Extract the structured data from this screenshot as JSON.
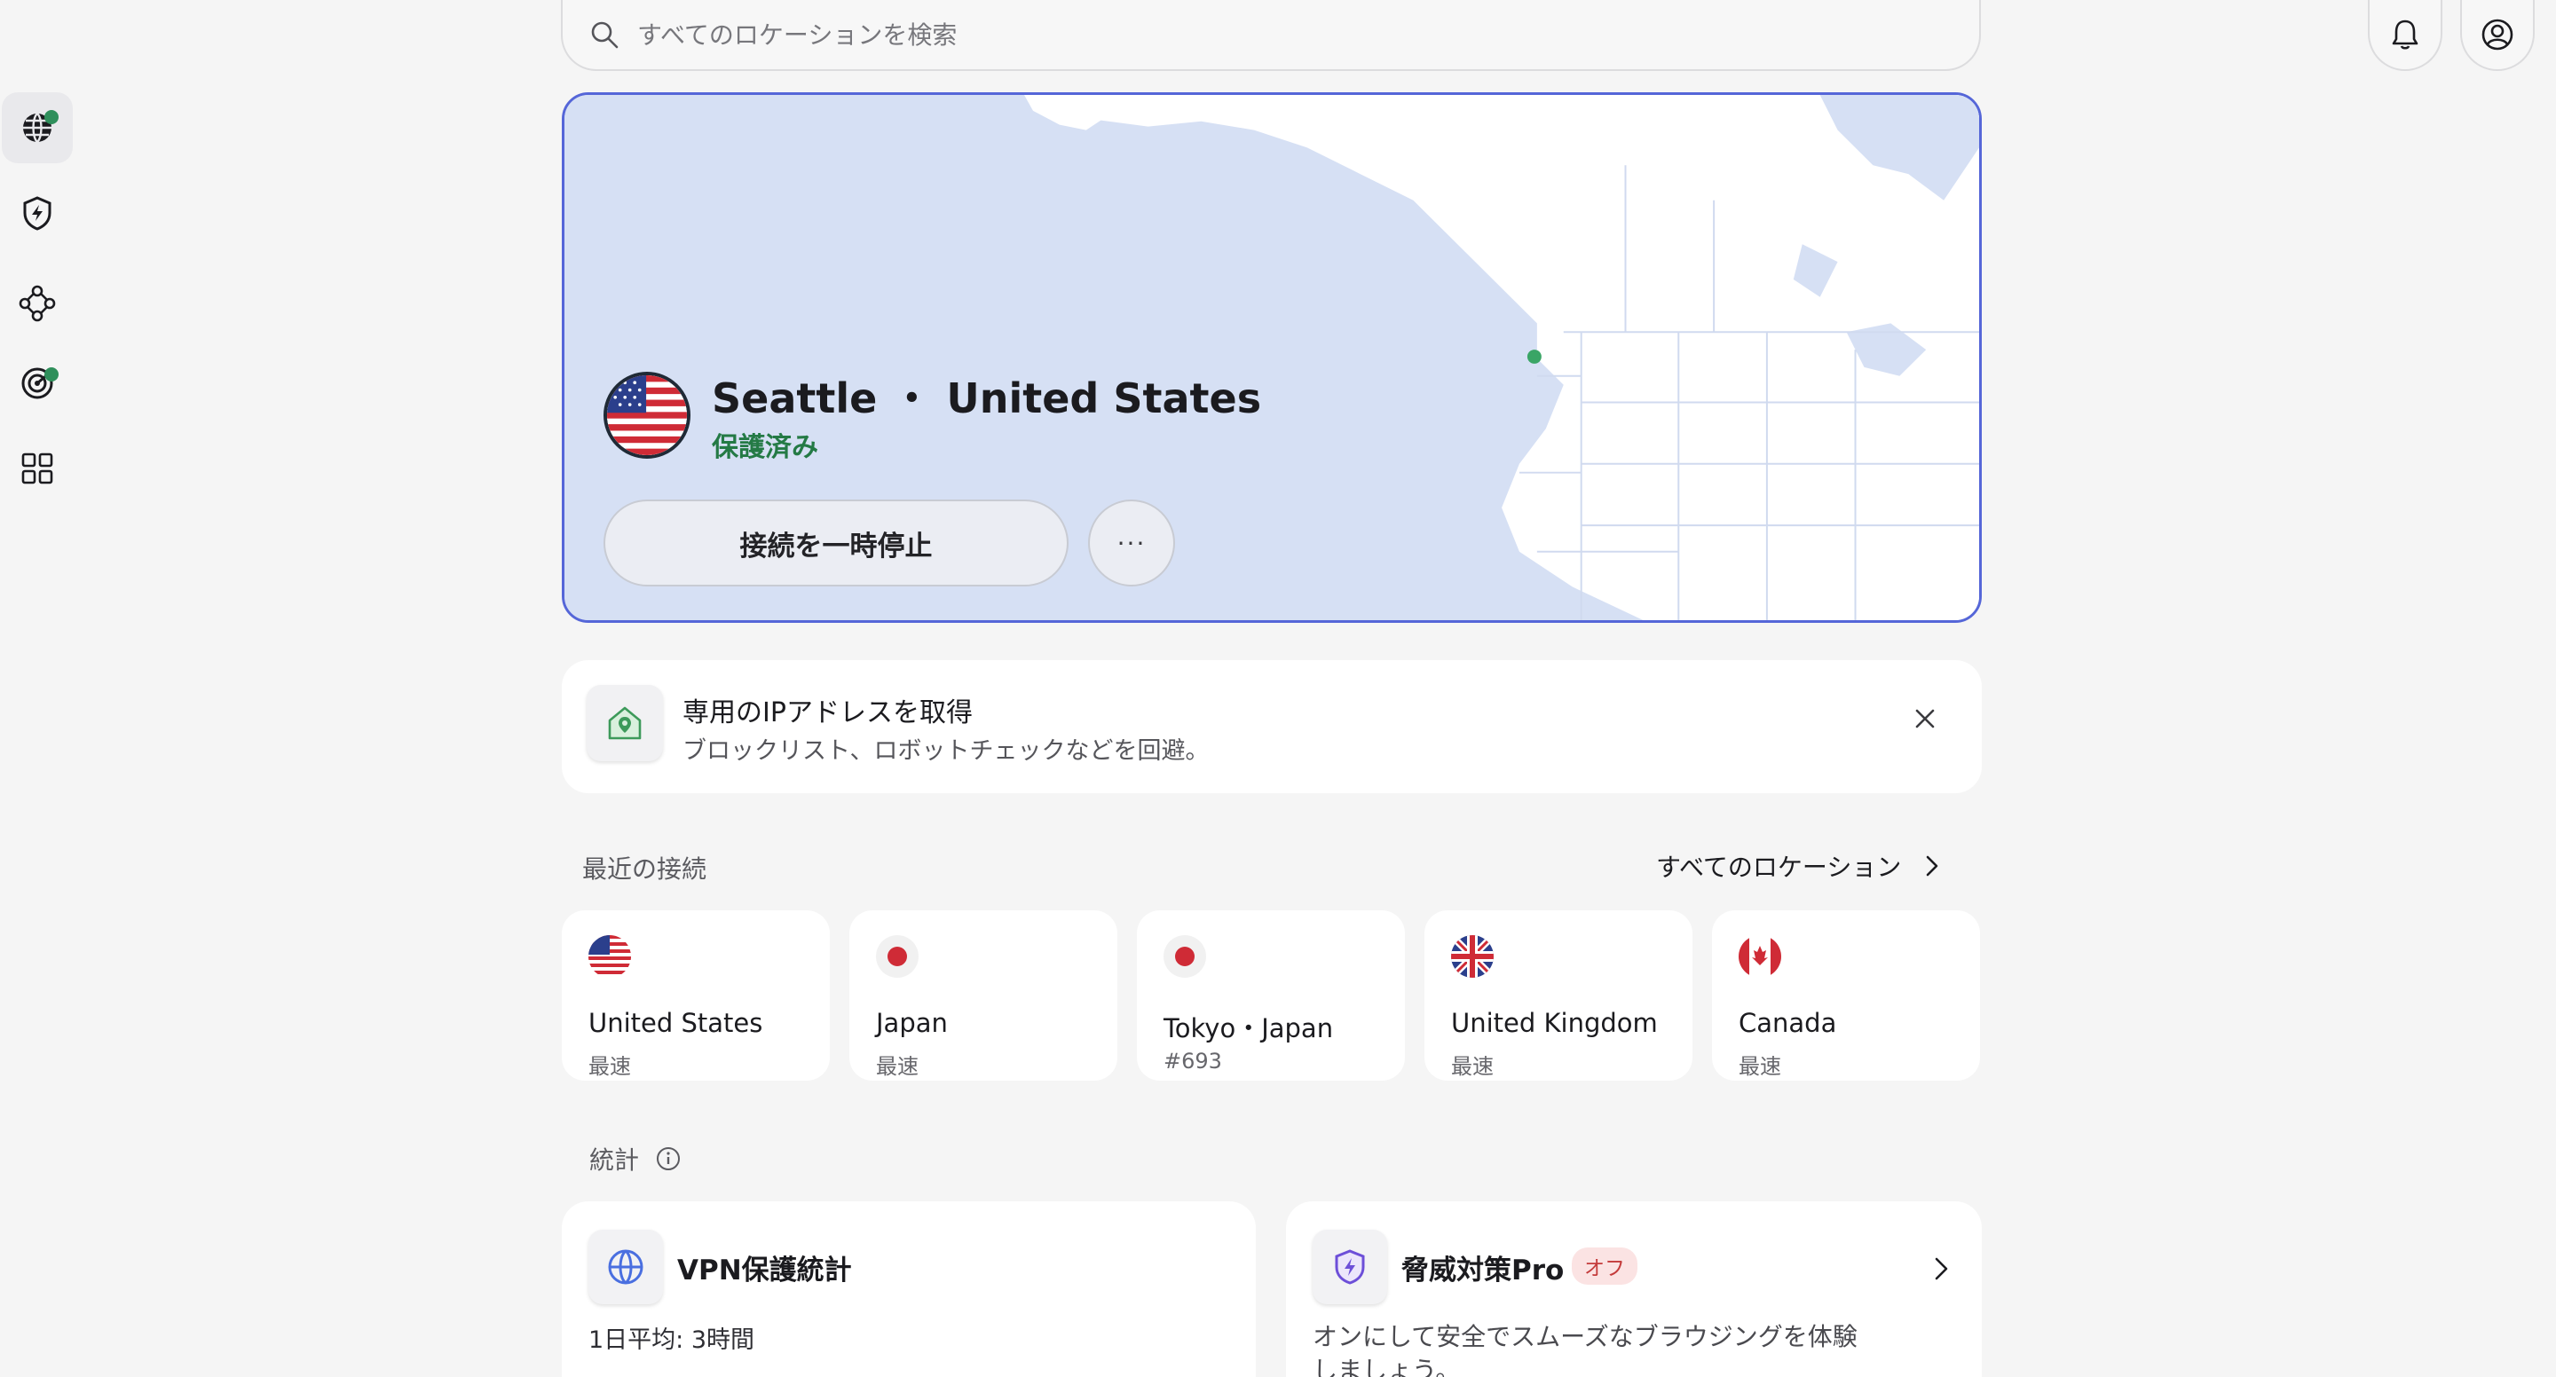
{
  "search": {
    "placeholder": "すべてのロケーションを検索"
  },
  "sidebar": {
    "items": [
      {
        "name": "globe-icon",
        "active": true,
        "badge": true
      },
      {
        "name": "threat-shield-icon",
        "active": false,
        "badge": false
      },
      {
        "name": "meshnet-icon",
        "active": false,
        "badge": false
      },
      {
        "name": "radar-icon",
        "active": false,
        "badge": true
      },
      {
        "name": "apps-grid-icon",
        "active": false,
        "badge": false
      }
    ]
  },
  "header": {
    "notifications_icon": "bell-icon",
    "account_icon": "user-icon"
  },
  "hero": {
    "location": "Seattle ・ United States",
    "status": "保護済み",
    "pause_label": "接続を一時停止",
    "more_label": "···",
    "status_color": "#247a45",
    "accent": "#5566d8"
  },
  "promo": {
    "title": "専用のIPアドレスを取得",
    "subtitle": "ブロックリスト、ロボットチェックなどを回避。"
  },
  "recent": {
    "label": "最近の接続",
    "all_label": "すべてのロケーション",
    "items": [
      {
        "flag": "us",
        "name": "United States",
        "sub": "最速"
      },
      {
        "flag": "jp",
        "name": "Japan",
        "sub": "最速"
      },
      {
        "flag": "jp",
        "name": "Tokyo・Japan",
        "sub": "#693"
      },
      {
        "flag": "uk",
        "name": "United Kingdom",
        "sub": "最速"
      },
      {
        "flag": "ca",
        "name": "Canada",
        "sub": "最速"
      }
    ]
  },
  "stats": {
    "label": "統計",
    "vpn": {
      "title": "VPN保護統計",
      "sub": "1日平均: 3時間"
    },
    "threat": {
      "title": "脅威対策Pro",
      "badge": "オフ",
      "sub": "オンにして安全でスムーズなブラウジングを体験しましょう。"
    }
  }
}
